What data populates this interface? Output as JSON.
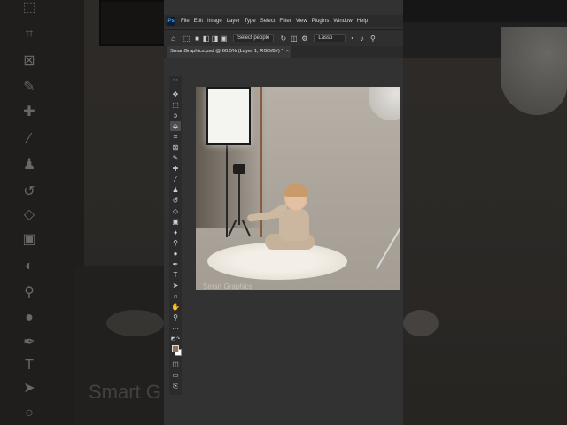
{
  "app": {
    "logo_text": "Ps",
    "menu": [
      "File",
      "Edit",
      "Image",
      "Layer",
      "Type",
      "Select",
      "Filter",
      "View",
      "Plugins",
      "Window",
      "Help"
    ]
  },
  "options_bar": {
    "select_people_label": "Select people",
    "lasso_label": "Lasso",
    "icons": [
      "home-icon",
      "selection-mode-icon",
      "new-selection-icon",
      "add-selection-icon",
      "subtract-selection-icon",
      "intersect-selection-icon",
      "refresh-icon",
      "gear-icon",
      "bell-icon",
      "search-icon"
    ]
  },
  "document": {
    "tab_title": "SmartGraphics.psd @ 60.5% (Layer 1, RGB/8#) *",
    "close_glyph": "×"
  },
  "toolbar": {
    "tools": [
      "move-tool",
      "marquee-tool",
      "lasso-tool",
      "object-selection-tool",
      "crop-tool",
      "frame-tool",
      "eyedropper-tool",
      "healing-brush-tool",
      "brush-tool",
      "clone-stamp-tool",
      "history-brush-tool",
      "eraser-tool",
      "gradient-tool",
      "blur-tool",
      "dodge-tool",
      "pen-tool",
      "type-tool",
      "path-selection-tool",
      "shape-tool",
      "hand-tool",
      "zoom-tool",
      "more-tools"
    ],
    "foreground_color": "#8b7461",
    "background_color": "#ffffff"
  },
  "canvas": {
    "watermark": "Smart Graphics"
  },
  "background_blur": {
    "watermark": "Smart G"
  }
}
